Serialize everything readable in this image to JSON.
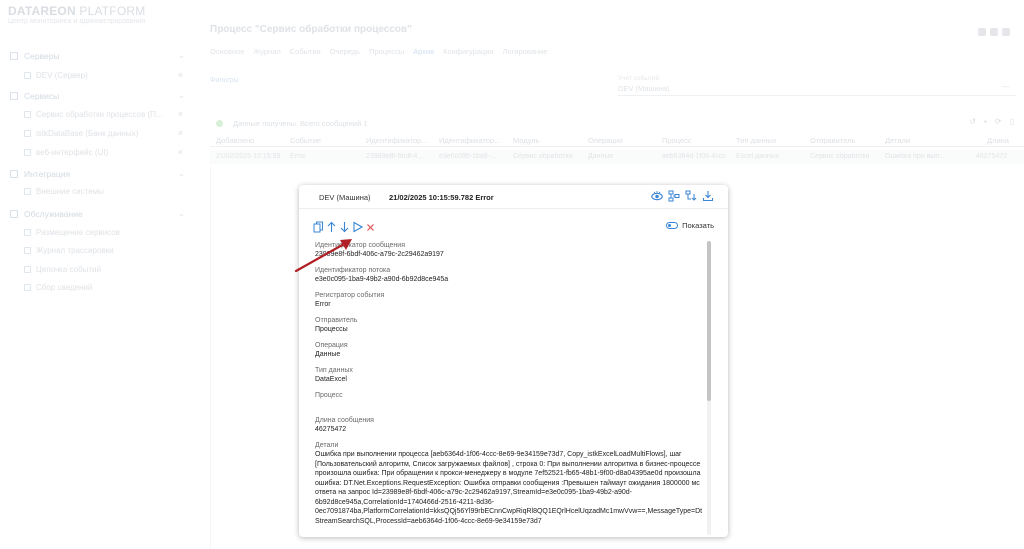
{
  "brand": {
    "name_bold": "DATAREON",
    "name_light": " PLATFORM",
    "subtitle": "Центр мониторинга и администрирования"
  },
  "sidebar": {
    "sections": [
      {
        "label": "Серверы",
        "items": [
          {
            "label": "DEV (Сервер)"
          }
        ]
      },
      {
        "label": "Сервисы",
        "items": [
          {
            "label": "Сервис обработки процессов (П..."
          },
          {
            "label": "istkDataBase (Банк данных)"
          },
          {
            "label": "веб-интерфейс (UI)"
          }
        ]
      },
      {
        "label": "Интеграция",
        "items": [
          {
            "label": "Внешние системы"
          }
        ]
      },
      {
        "label": "Обслуживание",
        "items": [
          {
            "label": "Размещение сервисов"
          },
          {
            "label": "Журнал трассировки"
          },
          {
            "label": "Цепочка событий"
          },
          {
            "label": "Сбор сведений"
          }
        ]
      }
    ]
  },
  "main": {
    "title": "Процесс \"Сервис обработки процессов\"",
    "tabs": [
      "Основное",
      "Журнал",
      "События",
      "Очередь",
      "Процессы",
      "Архив",
      "Конфигурация",
      "Логирование"
    ],
    "active_tab": "Архив",
    "filters_link": "Фильтры",
    "source_select": {
      "label": "Учет событий",
      "value": "DEV (Машина)"
    },
    "status_text": "Данные получены. Всего сообщений 1",
    "columns": [
      "Добавлено",
      "Событие",
      "Идентификатор...",
      "Идентификатор...",
      "Модуль",
      "Операция",
      "Процесс",
      "Тип данных",
      "Отправитель",
      "Детали",
      "Длина"
    ],
    "row": [
      "21/02/2025 10:15:59",
      "Error",
      "23989e8f-6bdf-4...",
      "e3e0c095-1ba9-...",
      "Сервис обработки",
      "Данные",
      "aeb6364d-1f06-4ccc",
      "Excel данных",
      "Сервис обработки",
      "Ошибка при вып...",
      "46275472"
    ]
  },
  "modal": {
    "source": "DEV (Машина)",
    "event": "21/02/2025 10:15:59.782 Error",
    "show_label": "Показать",
    "fields": [
      {
        "label": "Идентификатор сообщения",
        "value": "23989e8f-6bdf-406c-a79c-2c29462a9197"
      },
      {
        "label": "Идентификатор потока",
        "value": "e3e0c095-1ba9-49b2-a90d-6b92d8ce945a"
      },
      {
        "label": "Регистратор события",
        "value": "Error"
      },
      {
        "label": "Отправитель",
        "value": "Процессы"
      },
      {
        "label": "Операция",
        "value": "Данные"
      },
      {
        "label": "Тип данных",
        "value": "DataExcel"
      },
      {
        "label": "Процесс",
        "value": ""
      },
      {
        "label": "Длина сообщения",
        "value": "46275472"
      }
    ],
    "details_label": "Детали",
    "details_value": "Ошибка при выполнении процесса [aeb6364d-1f06-4ccc-8e69-9e34159e73d7, Copy_istkExcelLoadMultiFlows], шаг [Пользовательский алгоритм, Список загружаемых файлов] , строка 0: При выполнении алгоритма в бизнес-процессе произошла ошибка: При обращении к прокси-менеджеру в модуле 7ef52521-fb65-48b1-9f00-d8a04395ae0d произошла ошибка: DT.Net.Exceptions.RequestException: Ошибка отправки сообщения :Превышен таймаут ожидания 1800000 мс ответа на запрос Id=23989e8f-6bdf-406c-a79c-2c29462a9197,StreamId=e3e0c095-1ba9-49b2-a90d-6b92d8ce945a,CorrelationId=1740466d-2516-4211-8d36-0ec7091874ba,PlatformCorrelationId=kksQQj56Yl99rbECnnCwpRiqRl8QQ1EQrlHcelUqzadMc1mwVvw==,MessageType=DtStreamSearchSQL,ProcessId=aeb6364d-1f06-4ccc-8e69-9e34159e73d7"
  },
  "colors": {
    "accent": "#3a86d6",
    "close": "#e0504f",
    "annotation": "#b11e24"
  }
}
